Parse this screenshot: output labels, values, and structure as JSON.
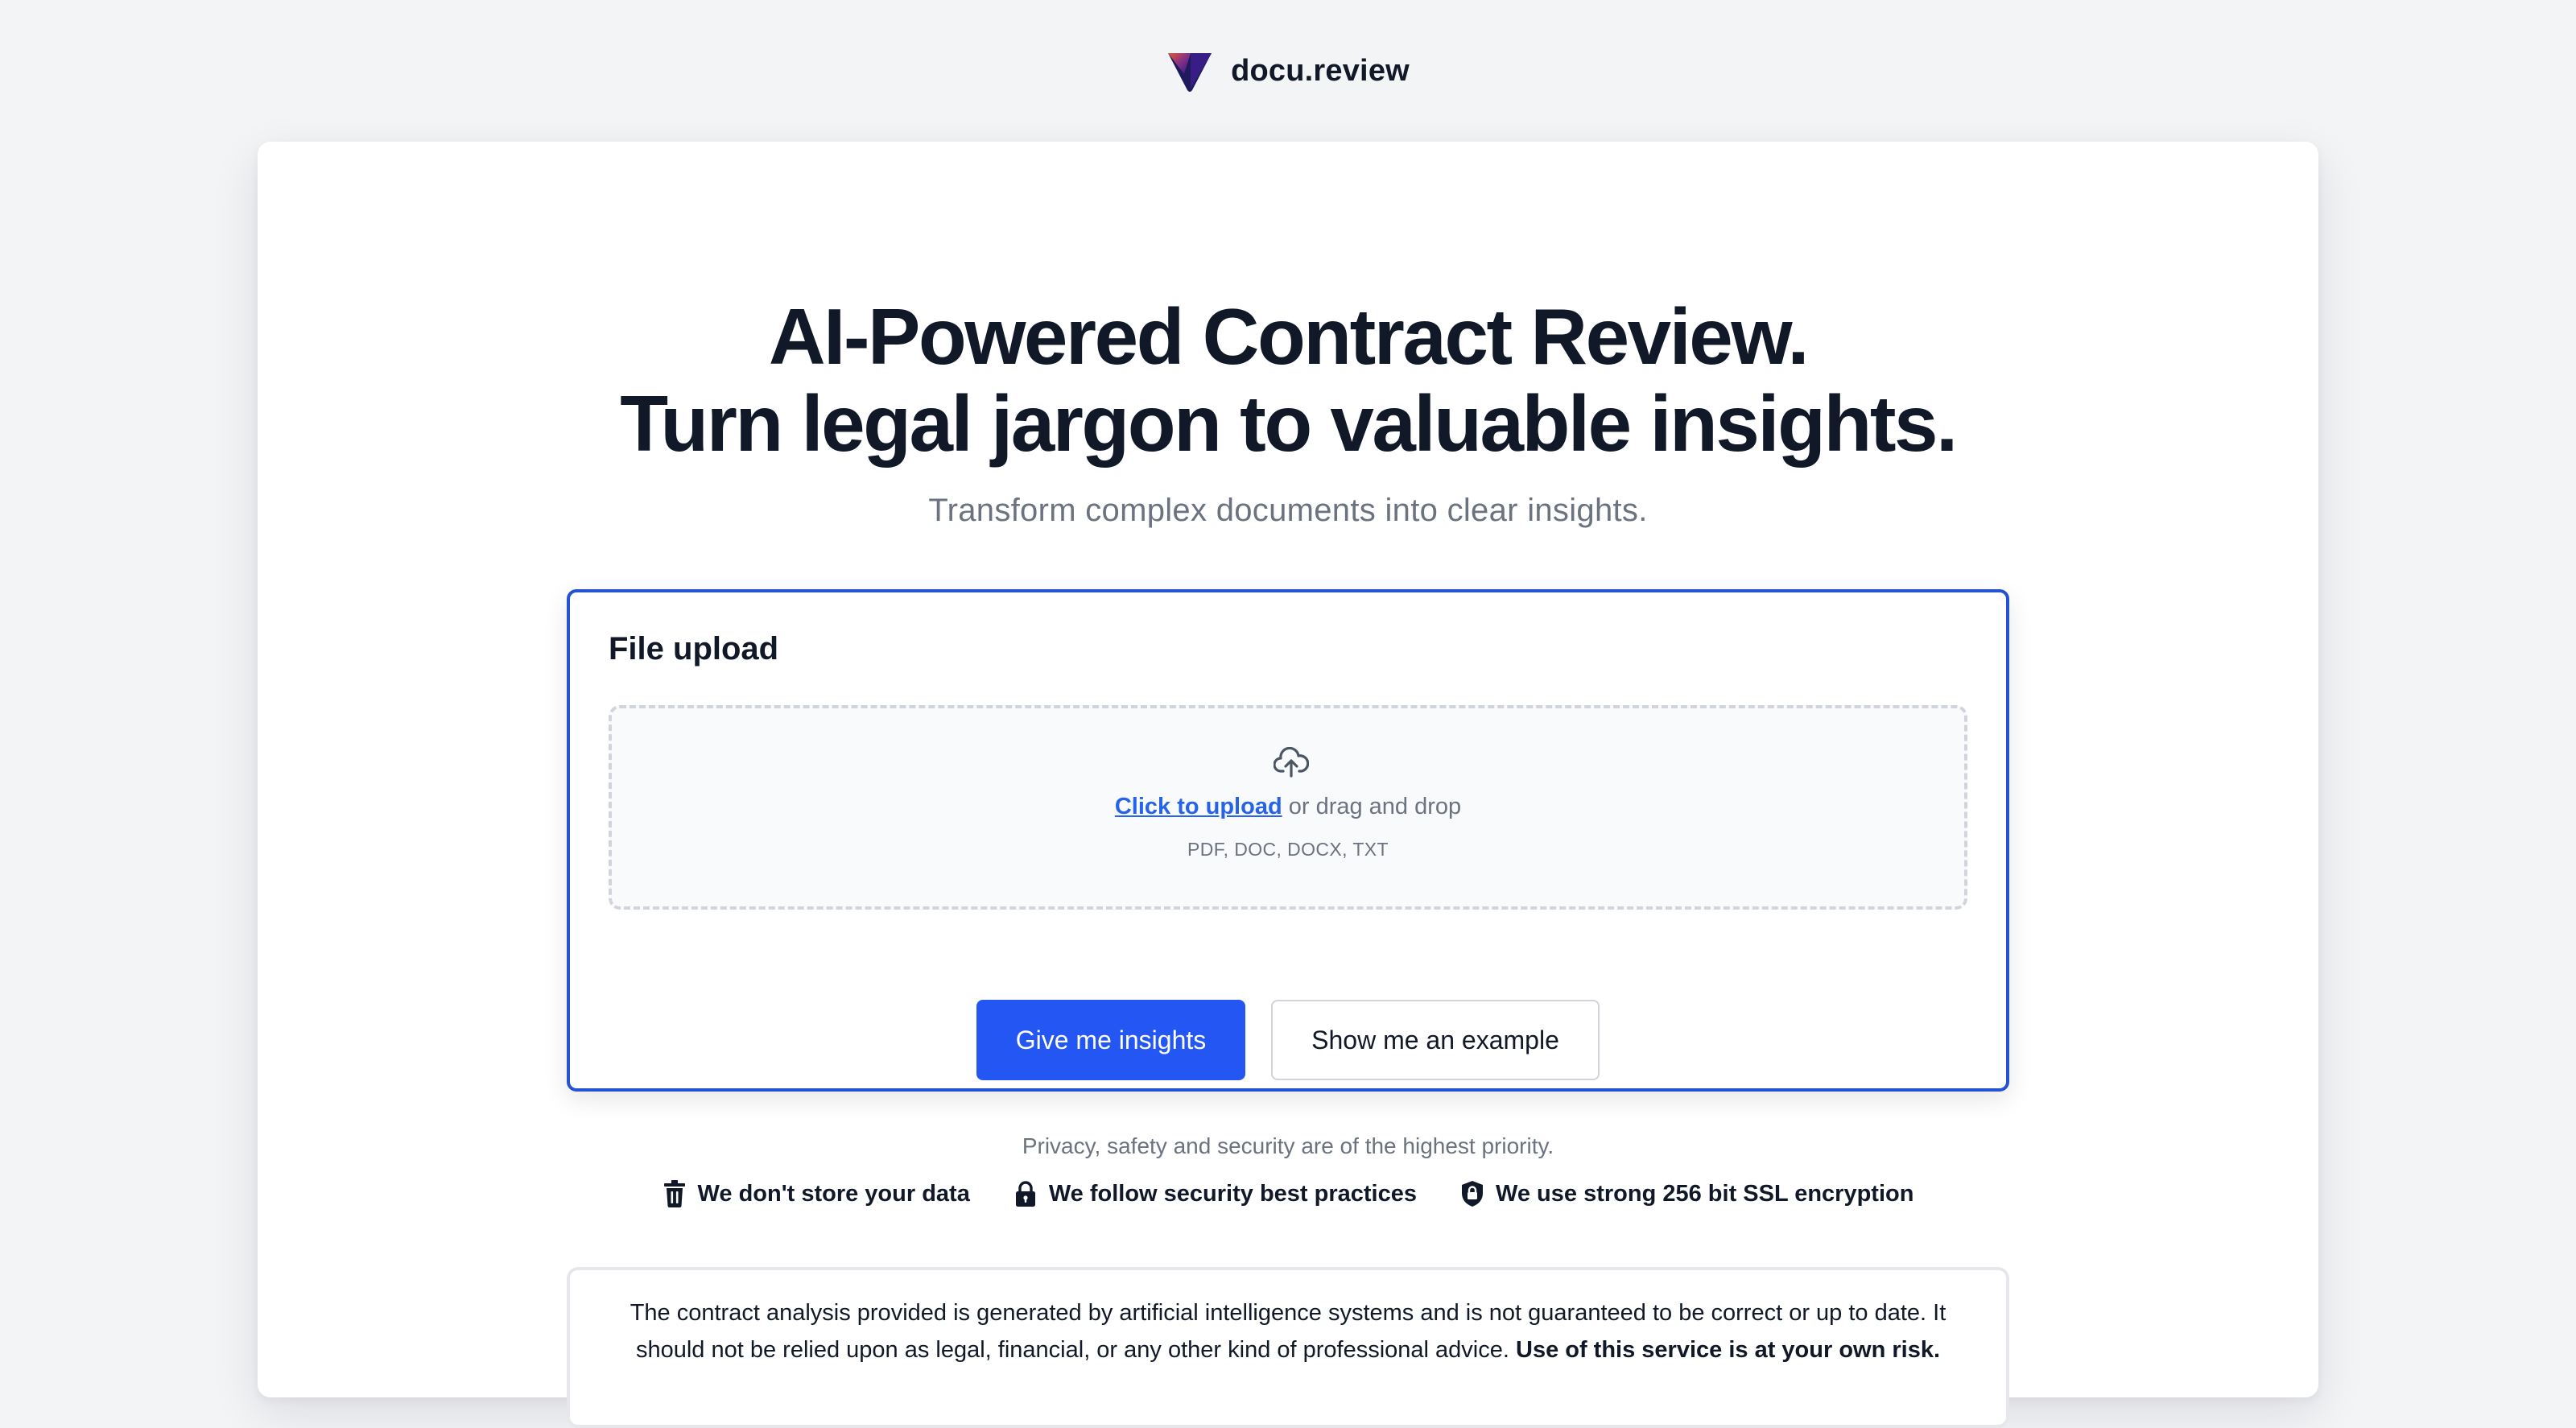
{
  "brand": {
    "name": "docu.review"
  },
  "hero": {
    "headline_line1": "AI-Powered Contract Review.",
    "headline_line2": "Turn legal jargon to valuable insights.",
    "subheadline": "Transform complex documents into clear insights."
  },
  "upload": {
    "title": "File upload",
    "link_text": "Click to upload",
    "drag_text": " or drag and drop",
    "formats": "PDF, DOC, DOCX, TXT",
    "icon": "cloud-upload-icon"
  },
  "actions": {
    "primary_label": "Give me insights",
    "secondary_label": "Show me an example"
  },
  "trust": {
    "headline": "Privacy, safety and security are of the highest priority.",
    "badges": [
      {
        "icon": "trash-icon",
        "label": "We don't store your data"
      },
      {
        "icon": "lock-icon",
        "label": "We follow security best practices"
      },
      {
        "icon": "shield-lock-icon",
        "label": "We use strong 256 bit SSL encryption"
      }
    ]
  },
  "disclaimer": {
    "text": "The contract analysis provided is generated by artificial intelligence systems and is not guaranteed to be correct or up to date. It should not be relied upon as legal, financial, or any other kind of professional advice.",
    "emphasis": "Use of this service is at your own risk."
  },
  "colors": {
    "accent": "#2356f2",
    "link": "#2563eb",
    "panel_border": "#2153d4",
    "text": "#111827",
    "muted": "#6b7280",
    "background": "#f3f4f6"
  }
}
